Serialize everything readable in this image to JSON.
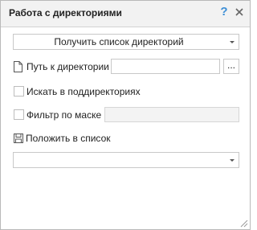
{
  "window": {
    "title": "Работа с директориями",
    "help_glyph": "?"
  },
  "action_dropdown": {
    "selected": "Получить список директорий"
  },
  "directory_path": {
    "label": "Путь к директории",
    "value": "",
    "browse_label": "..."
  },
  "search_subdirs": {
    "label": "Искать в поддиректориях",
    "checked": false
  },
  "mask_filter": {
    "label": "Фильтр по маске",
    "checked": false,
    "value": ""
  },
  "put_to_list": {
    "label": "Положить в список",
    "selected": ""
  },
  "colors": {
    "accent": "#3d8fd6",
    "border": "#c8c8c8",
    "titlebar_bg": "#f2f2f2"
  },
  "icons": [
    "help-icon",
    "close-icon",
    "file-icon",
    "save-icon",
    "chevron-down-icon",
    "resize-grip-icon"
  ]
}
